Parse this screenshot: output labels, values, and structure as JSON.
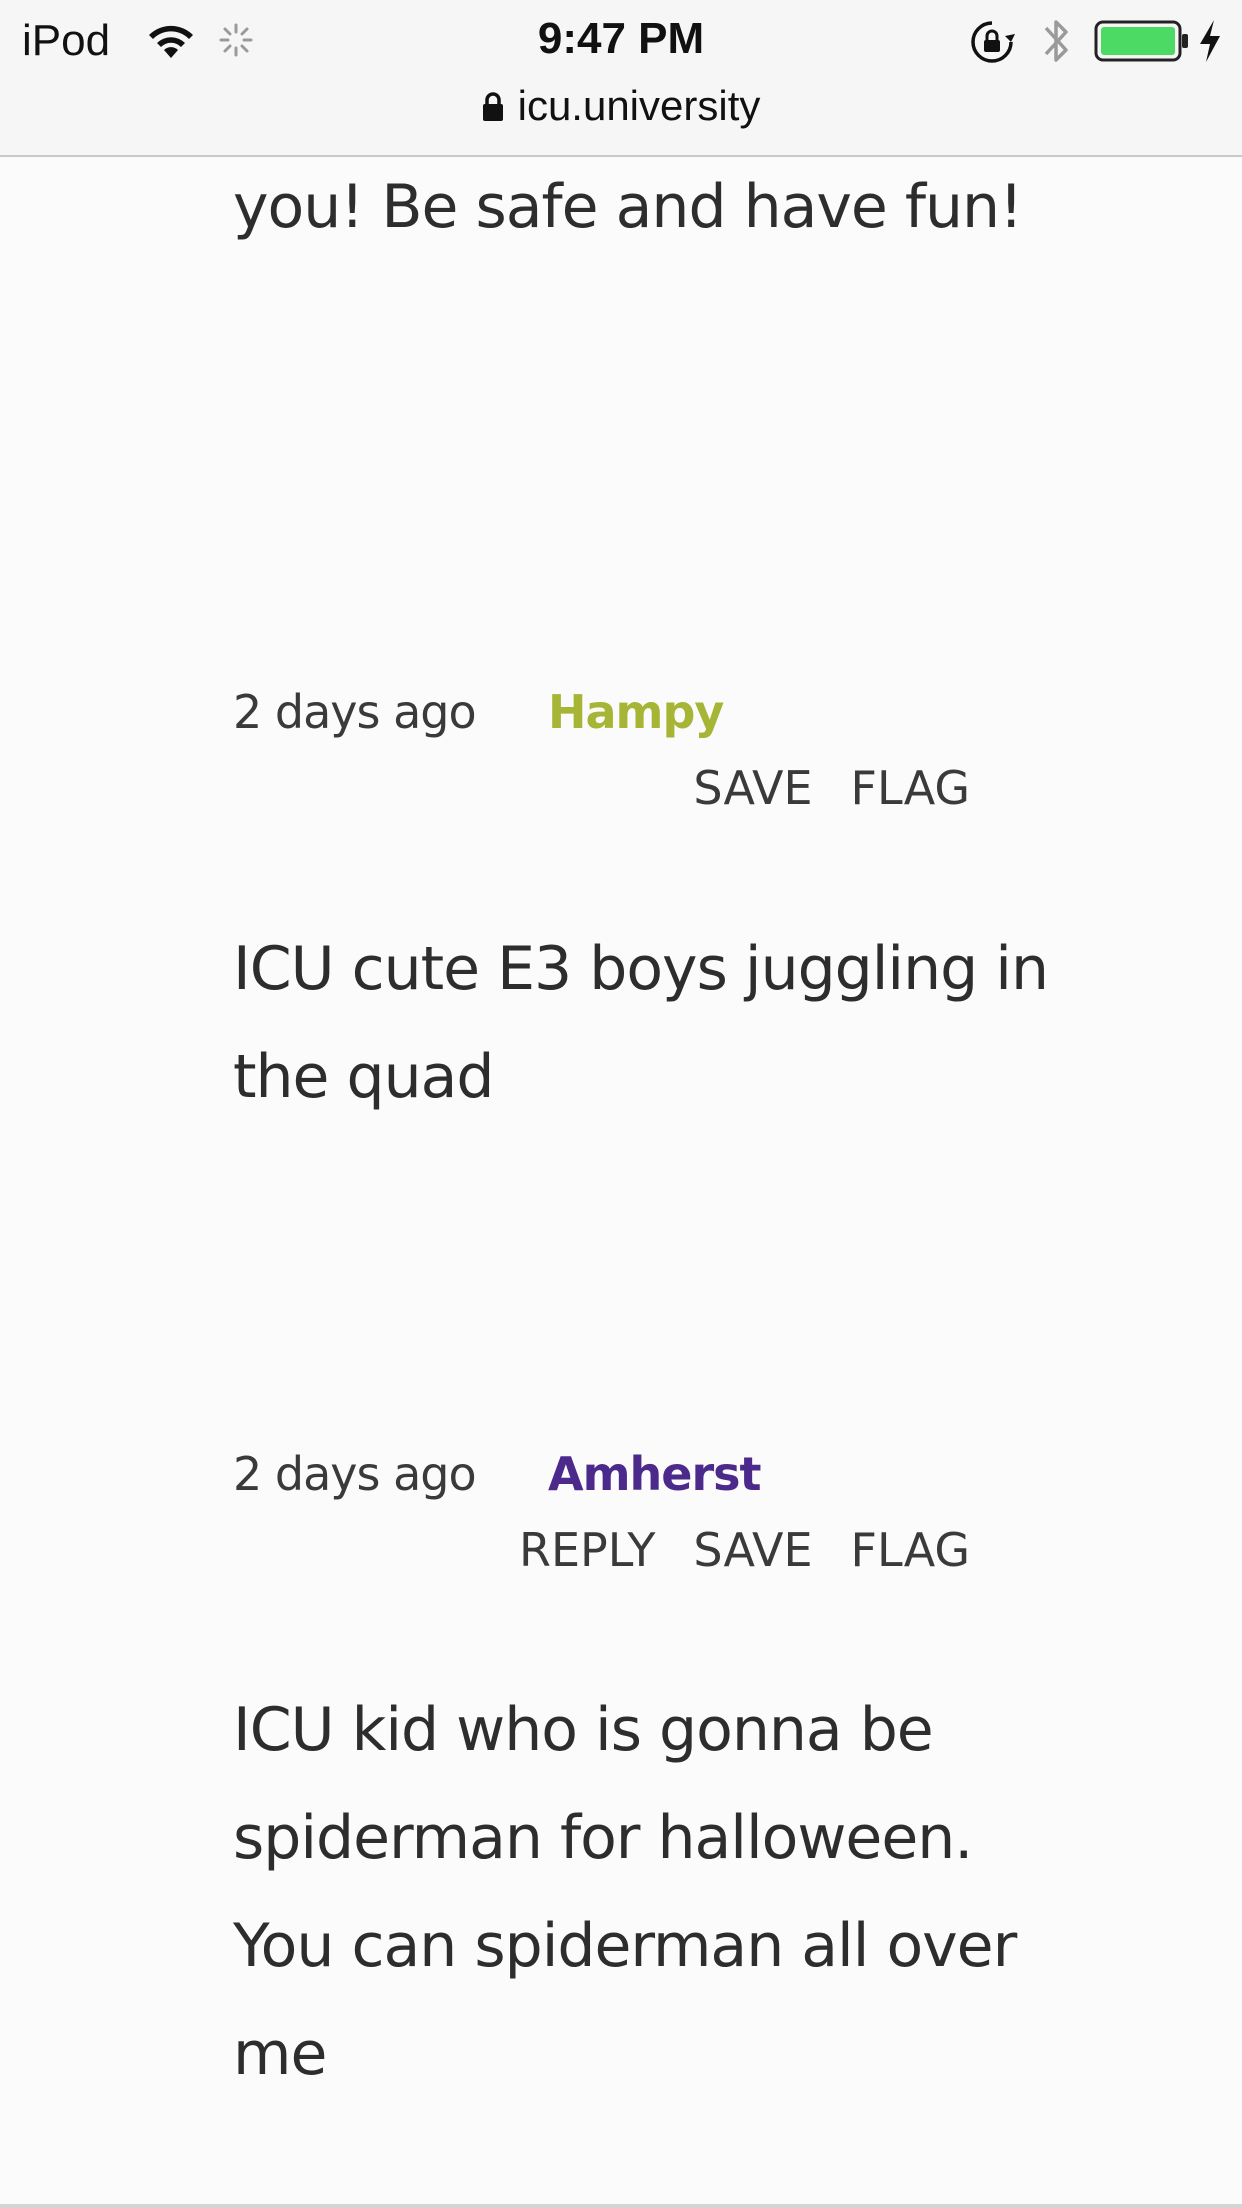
{
  "status_bar": {
    "carrier": "iPod",
    "time": "9:47 PM",
    "icons": [
      "wifi-icon",
      "activity-spinner-icon",
      "rotation-lock-icon",
      "bluetooth-icon",
      "battery-icon",
      "charging-bolt-icon"
    ],
    "battery_color": "#4cd964"
  },
  "url_bar": {
    "domain": "icu.university",
    "icon": "lock-icon"
  },
  "posts": [
    {
      "text": "you! Be safe and have fun!"
    },
    {
      "time_ago": "2 days ago",
      "user": "Hampy",
      "user_color": "#a6b535",
      "actions": [
        "SAVE",
        "FLAG"
      ],
      "text": "ICU cute E3 boys juggling in the quad"
    },
    {
      "time_ago": "2 days ago",
      "user": "Amherst",
      "user_color": "#4b2a8c",
      "actions": [
        "REPLY",
        "SAVE",
        "FLAG"
      ],
      "text": "ICU kid who is gonna be spiderman for halloween. You can spiderman all over me"
    }
  ]
}
